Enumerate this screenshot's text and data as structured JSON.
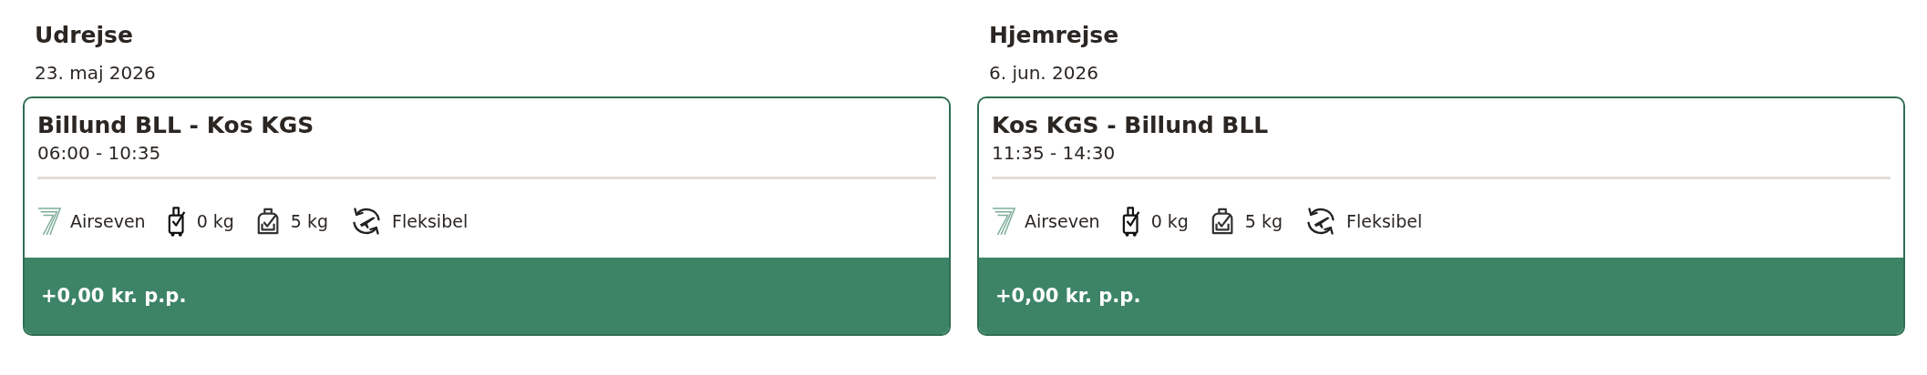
{
  "legs": [
    {
      "heading": "Udrejse",
      "date": "23. maj 2026",
      "route": "Billund BLL - Kos KGS",
      "times": "06:00 - 10:35",
      "airline": "Airseven",
      "carry_on": "0 kg",
      "personal_item": "5 kg",
      "flex": "Fleksibel",
      "price": "+0,00 kr. p.p."
    },
    {
      "heading": "Hjemrejse",
      "date": "6. jun. 2026",
      "route": "Kos KGS - Billund BLL",
      "times": "11:35 - 14:30",
      "airline": "Airseven",
      "carry_on": "0 kg",
      "personal_item": "5 kg",
      "flex": "Fleksibel",
      "price": "+0,00 kr. p.p."
    }
  ]
}
